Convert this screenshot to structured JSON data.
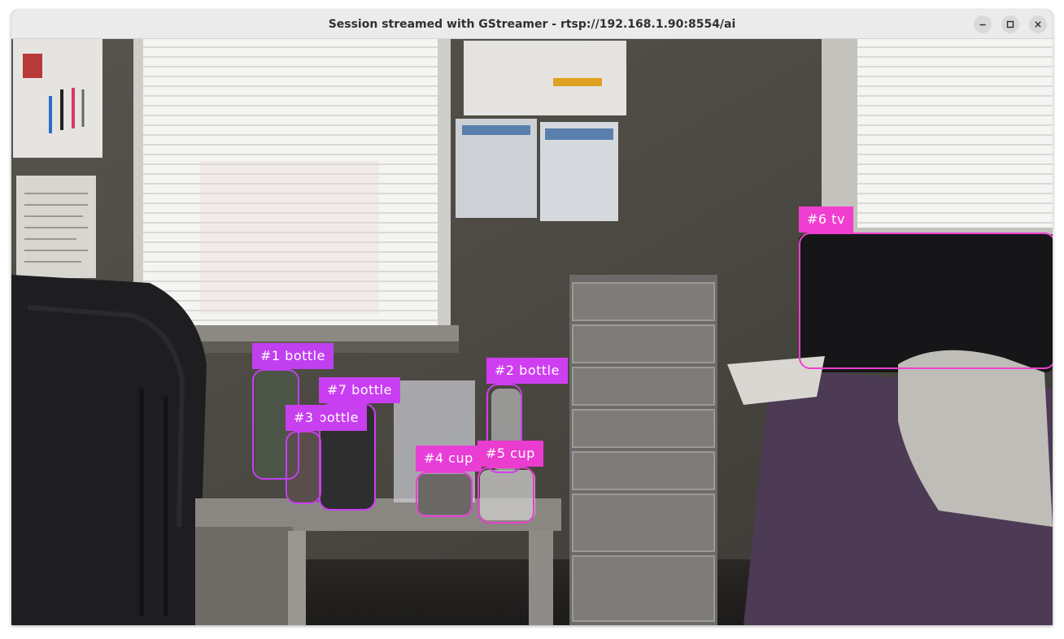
{
  "window": {
    "title": "Session streamed with GStreamer - rtsp://192.168.1.90:8554/ai",
    "controls": {
      "minimize": "minimize-icon",
      "maximize": "maximize-icon",
      "close": "close-icon"
    }
  },
  "stream": {
    "detections": [
      {
        "label": "#1 bottle",
        "color": "#c040f0"
      },
      {
        "label": "#2 bottle",
        "color": "#cf3ef0"
      },
      {
        "label": "#3 bottle",
        "color": "#c83ff0"
      },
      {
        "label": "#4 cup",
        "color": "#e83ed8"
      },
      {
        "label": "#5 cup",
        "color": "#ea3ccf"
      },
      {
        "label": "#6 tv",
        "color": "#f03fd0"
      },
      {
        "label": "#7 bottle",
        "color": "#c93ef2"
      }
    ]
  }
}
